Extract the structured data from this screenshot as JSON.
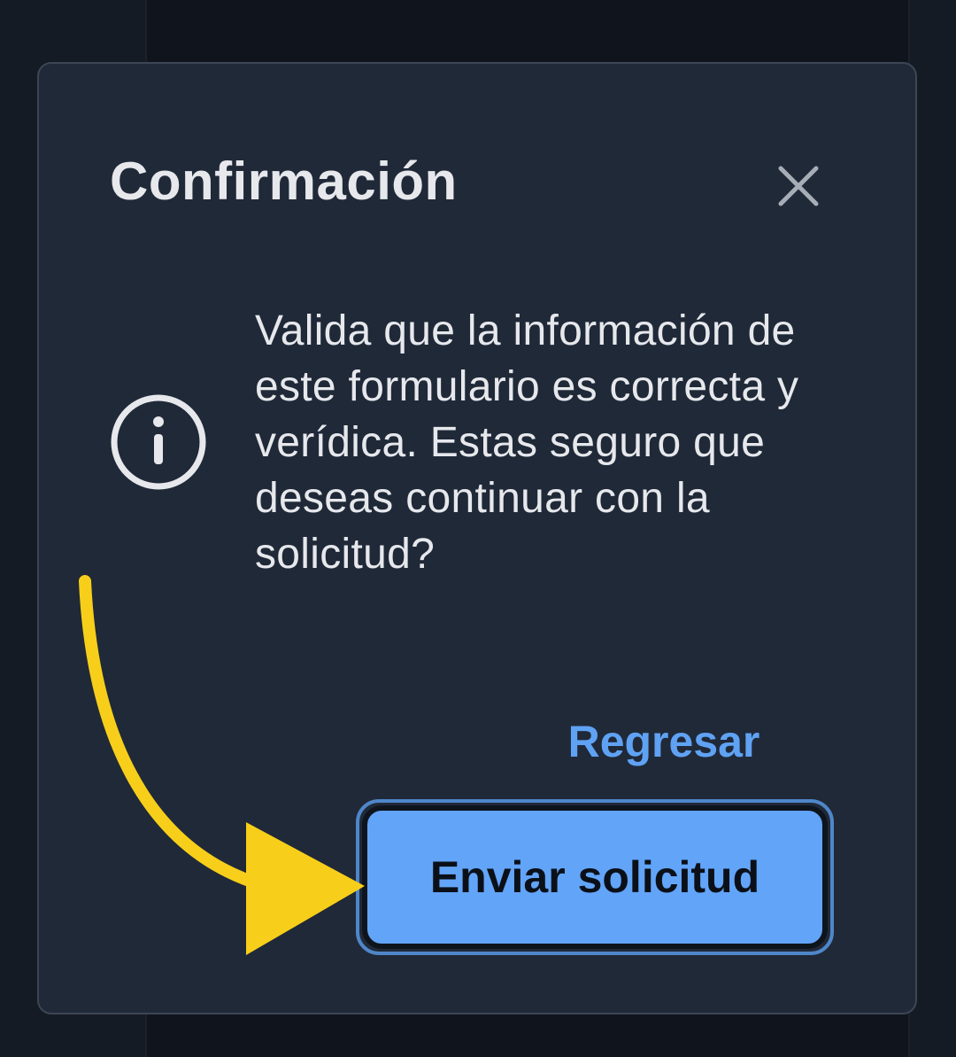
{
  "dialog": {
    "title": "Confirmación",
    "close_icon": "close-icon",
    "info_icon": "info-icon",
    "message": "Valida que la información de este formulario es correcta y verídica. Estas seguro que deseas continuar con la solicitud?",
    "secondary_action": "Regresar",
    "primary_action": "Enviar solicitud"
  },
  "colors": {
    "dialog_background": "#202938",
    "primary_button": "#62a4f8",
    "link": "#5fa2f4",
    "annotation_arrow": "#f7cf1a"
  }
}
